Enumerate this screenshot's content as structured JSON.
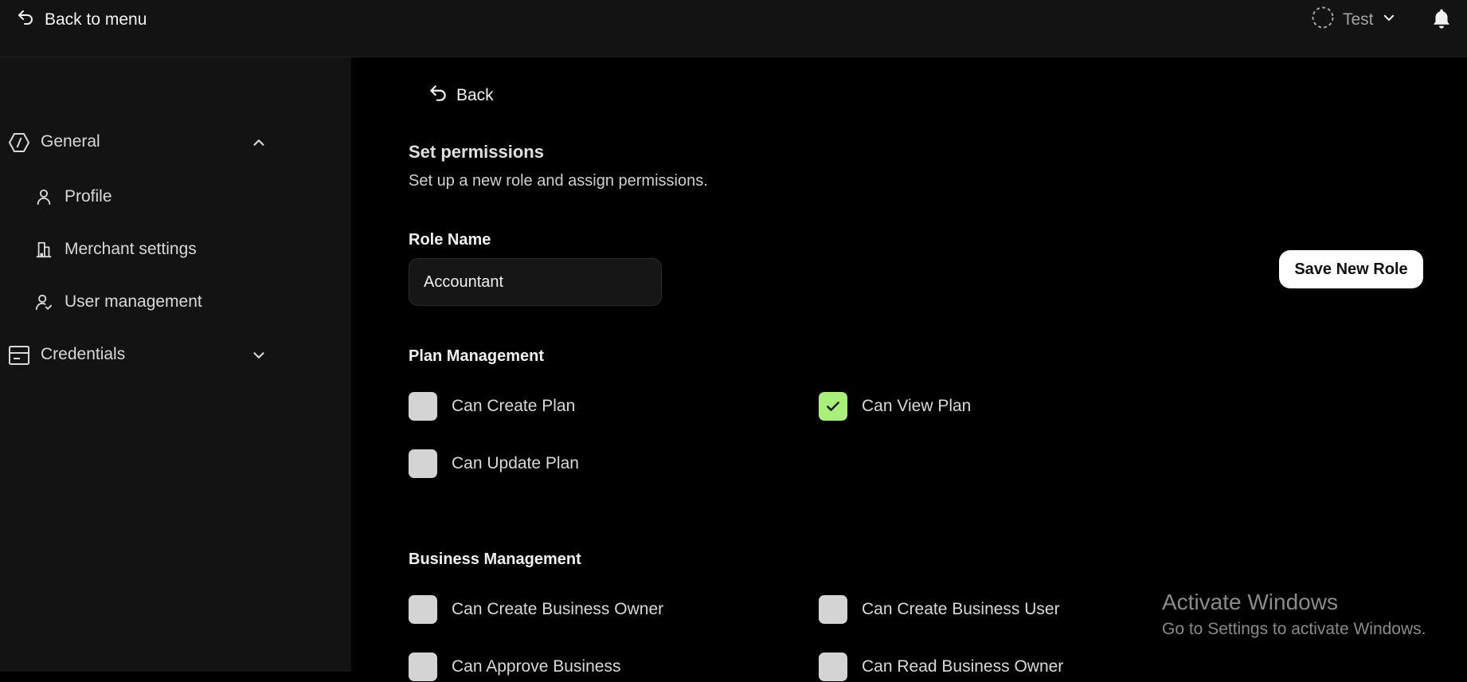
{
  "topbar": {
    "back_to_menu": "Back to menu",
    "environment": "Test"
  },
  "sidebar": {
    "groups": [
      {
        "label": "General",
        "icon": "hexagon-icon",
        "expanded": true,
        "items": [
          {
            "label": "Profile",
            "icon": "user-icon"
          },
          {
            "label": "Merchant settings",
            "icon": "building-icon"
          },
          {
            "label": "User management",
            "icon": "user-check-icon"
          }
        ]
      },
      {
        "label": "Credentials",
        "icon": "card-icon",
        "expanded": false
      }
    ]
  },
  "main": {
    "back_label": "Back",
    "title": "Set permissions",
    "subtitle": "Set up a new role and assign permissions.",
    "role_name_label": "Role Name",
    "role_name_value": "Accountant",
    "save_label": "Save New Role",
    "sections": [
      {
        "title": "Plan Management",
        "permissions": [
          {
            "label": "Can Create Plan",
            "checked": false
          },
          {
            "label": "Can View Plan",
            "checked": true
          },
          {
            "label": "Can Update Plan",
            "checked": false
          }
        ]
      },
      {
        "title": "Business Management",
        "permissions": [
          {
            "label": "Can Create Business Owner",
            "checked": false
          },
          {
            "label": "Can Create Business User",
            "checked": false
          },
          {
            "label": "Can Approve Business",
            "checked": false
          },
          {
            "label": "Can Read Business Owner",
            "checked": false
          }
        ]
      }
    ]
  },
  "watermark": {
    "title": "Activate Windows",
    "subtitle": "Go to Settings to activate Windows."
  },
  "colors": {
    "accent_checked": "#a8f07a",
    "sidebar_bg": "#131313",
    "main_bg": "#000000"
  }
}
